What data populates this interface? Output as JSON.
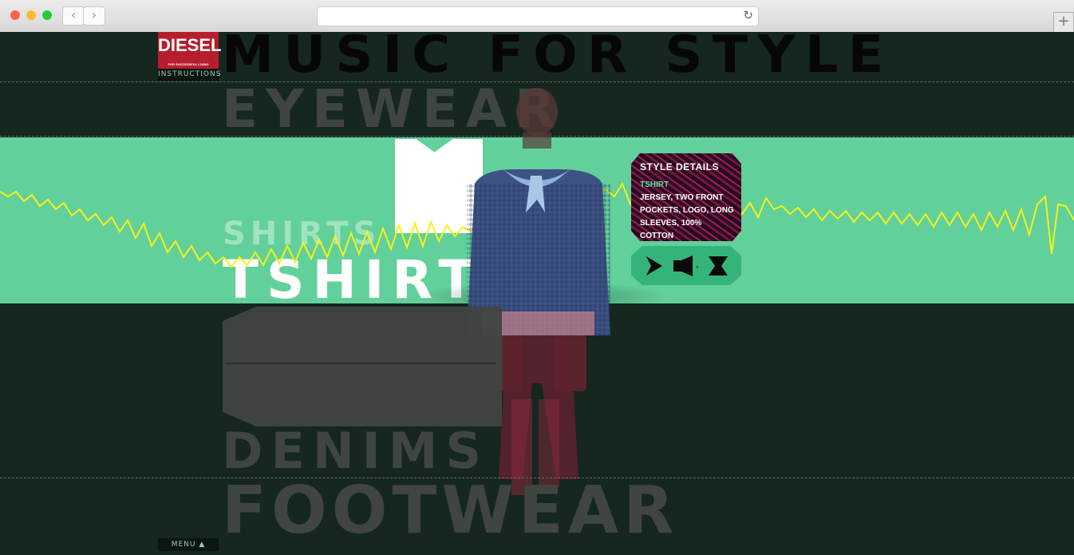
{
  "browser": {
    "url": "",
    "colors": {
      "close": "#fd5f57",
      "minimize": "#febc2e",
      "maximize": "#28c840"
    }
  },
  "brand": {
    "logo": "DIESEL",
    "tagline": "FOR SUCCESSFUL LIVING",
    "instructions_label": "INSTRUCTIONS",
    "menu_label": "MENU"
  },
  "headline": "MUSIC FOR STYLE",
  "categories": {
    "eyewear": "EYEWEAR",
    "shirts": "SHIRTS",
    "active": "TSHIRT",
    "denims": "DENIMS",
    "footwear": "FOOTWEAR"
  },
  "style_details": {
    "title": "STYLE DETAILS",
    "item_name": "TSHIRT",
    "description": "JERSEY, TWO FRONT POCKETS, LOGO, LONG SLEEVES, 100% COTTON"
  },
  "controls": {
    "play_icon": "play-icon",
    "volume_icon": "speaker-icon",
    "close_icon": "bowtie-close-icon"
  },
  "colors": {
    "background": "#15271f",
    "band": "#62d09a",
    "waveform": "#f4f21a",
    "brand_red": "#b71e2d",
    "accent_green": "#5fe0a0"
  }
}
